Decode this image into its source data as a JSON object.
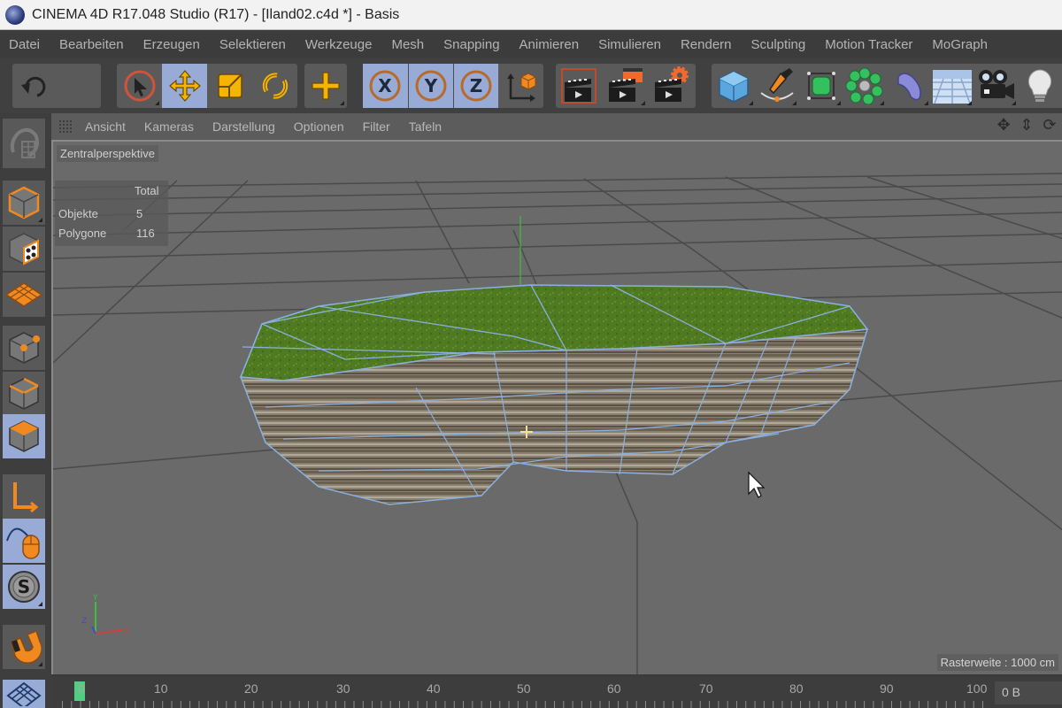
{
  "window": {
    "title": "CINEMA 4D R17.048 Studio (R17) - [Iland02.c4d *] - Basis"
  },
  "menubar": {
    "items": [
      "Datei",
      "Bearbeiten",
      "Erzeugen",
      "Selektieren",
      "Werkzeuge",
      "Mesh",
      "Snapping",
      "Animieren",
      "Simulieren",
      "Rendern",
      "Sculpting",
      "Motion Tracker",
      "MoGraph"
    ]
  },
  "toolbar": {
    "buttons": [
      {
        "icon": "undo-icon",
        "active": false
      },
      {
        "icon": "live-selection-icon",
        "active": false
      },
      {
        "icon": "move-icon",
        "active": true
      },
      {
        "icon": "scale-icon",
        "active": false
      },
      {
        "icon": "rotate-icon",
        "active": false
      },
      {
        "icon": "last-tool-icon",
        "active": false
      },
      {
        "icon": "x-axis-lock-icon",
        "label": "X",
        "active": true
      },
      {
        "icon": "y-axis-lock-icon",
        "label": "Y",
        "active": true
      },
      {
        "icon": "z-axis-lock-icon",
        "label": "Z",
        "active": true
      },
      {
        "icon": "coordinate-system-icon",
        "active": false
      },
      {
        "icon": "render-view-icon",
        "active": false
      },
      {
        "icon": "render-to-picture-viewer-icon",
        "active": false
      },
      {
        "icon": "render-settings-icon",
        "active": false
      },
      {
        "icon": "cube-icon",
        "active": false
      },
      {
        "icon": "spline-pen-icon",
        "active": false
      },
      {
        "icon": "subdivision-surface-icon",
        "active": false
      },
      {
        "icon": "cloner-icon",
        "active": false
      },
      {
        "icon": "deformer-bend-icon",
        "active": false
      },
      {
        "icon": "floor-icon",
        "active": false
      },
      {
        "icon": "camera-icon",
        "active": false
      },
      {
        "icon": "light-icon",
        "active": false
      }
    ]
  },
  "viewport_menu": {
    "items": [
      "Ansicht",
      "Kameras",
      "Darstellung",
      "Optionen",
      "Filter",
      "Tafeln"
    ]
  },
  "leftbar": {
    "buttons": [
      {
        "icon": "make-editable-icon",
        "active": false
      },
      {
        "icon": "model-mode-icon",
        "active": false
      },
      {
        "icon": "texture-mode-icon",
        "active": false
      },
      {
        "icon": "workplane-mode-icon",
        "active": false
      },
      {
        "icon": "points-mode-icon",
        "active": false
      },
      {
        "icon": "edges-mode-icon",
        "active": false
      },
      {
        "icon": "polygons-mode-icon",
        "active": true
      },
      {
        "icon": "axis-mode-icon",
        "active": false
      },
      {
        "icon": "tweak-mode-icon",
        "active": true
      },
      {
        "icon": "solo-mode-icon",
        "active": true
      },
      {
        "icon": "snap-magnet-icon",
        "active": false
      },
      {
        "icon": "workplane-grid-icon",
        "active": true
      }
    ]
  },
  "viewport": {
    "camera_label": "Zentralperspektive",
    "hud": {
      "header": "Total",
      "rows": [
        {
          "label": "Objekte",
          "value": "5"
        },
        {
          "label": "Polygone",
          "value": "116"
        }
      ]
    },
    "grid_spacing": "Rasterweite : 1000 cm",
    "axis_labels": {
      "x": "X",
      "y": "Y",
      "z": "Z"
    }
  },
  "timeline": {
    "current_frame": 0,
    "tick_labels": [
      "0",
      "10",
      "20",
      "30",
      "40",
      "50",
      "60",
      "70",
      "80",
      "90",
      "100"
    ],
    "memory": "0 B"
  },
  "colors": {
    "accent_orange": "#f0901e",
    "active_blue": "#97abd6",
    "grass_green": "#4f7a22",
    "playhead_green": "#4fcf7f"
  }
}
